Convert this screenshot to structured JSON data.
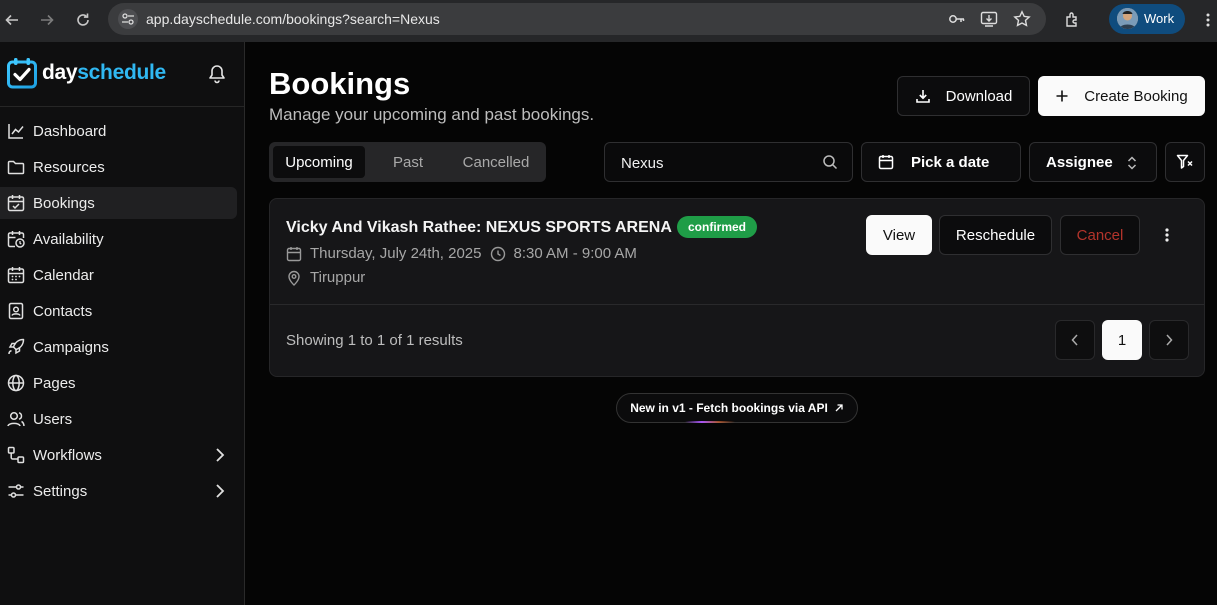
{
  "browser": {
    "url": "app.dayschedule.com/bookings?search=Nexus",
    "profile_label": "Work"
  },
  "brand": {
    "day": "day",
    "schedule": "schedule",
    "accent": "#30b8f2"
  },
  "sidebar": {
    "items": [
      {
        "label": "Dashboard",
        "icon": "chart-line-icon"
      },
      {
        "label": "Resources",
        "icon": "folder-icon"
      },
      {
        "label": "Bookings",
        "icon": "calendar-check-icon",
        "active": true
      },
      {
        "label": "Availability",
        "icon": "calendar-clock-icon"
      },
      {
        "label": "Calendar",
        "icon": "calendar-icon"
      },
      {
        "label": "Contacts",
        "icon": "contact-card-icon"
      },
      {
        "label": "Campaigns",
        "icon": "rocket-icon"
      },
      {
        "label": "Pages",
        "icon": "globe-icon"
      },
      {
        "label": "Users",
        "icon": "users-icon"
      },
      {
        "label": "Workflows",
        "icon": "workflow-icon",
        "expandable": true
      },
      {
        "label": "Settings",
        "icon": "sliders-icon",
        "expandable": true
      }
    ]
  },
  "header": {
    "title": "Bookings",
    "subtitle": "Manage your upcoming and past bookings.",
    "download_label": "Download",
    "create_label": "Create Booking"
  },
  "tabs": [
    {
      "label": "Upcoming",
      "active": true
    },
    {
      "label": "Past"
    },
    {
      "label": "Cancelled"
    }
  ],
  "filters": {
    "search_value": "Nexus",
    "date_label": "Pick a date",
    "assignee_label": "Assignee"
  },
  "booking": {
    "title": "Vicky And Vikash Rathee: NEXUS SPORTS ARENA",
    "status": "confirmed",
    "status_color": "#1f9d47",
    "date": "Thursday, July 24th, 2025",
    "time": "8:30 AM - 9:00 AM",
    "location": "Tiruppur",
    "view_label": "View",
    "reschedule_label": "Reschedule",
    "cancel_label": "Cancel",
    "cancel_color": "#b3342b"
  },
  "pagination": {
    "summary": "Showing 1 to 1 of 1 results",
    "current_page": "1"
  },
  "announcement": {
    "text": "New in v1 - Fetch bookings via API"
  }
}
